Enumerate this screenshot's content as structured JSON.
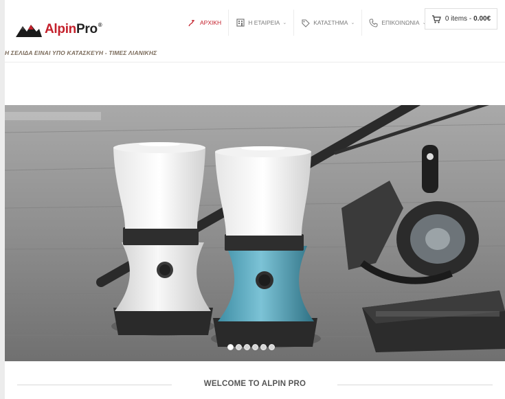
{
  "brand": {
    "name_red": "Alpin",
    "name_dark": "Pro",
    "registered": "®"
  },
  "tagline": "Η ΣΕΛΙΔΑ ΕΙΝΑΙ ΥΠΟ ΚΑΤΑΣΚΕΥΗ - ΤΙΜΕΣ ΛΙΑΝΙΚΗΣ",
  "nav": {
    "items": [
      {
        "label": "ΑΡΧΙΚΗ",
        "icon": "home-icon",
        "active": true
      },
      {
        "label": "Η ΕΤΑΙΡΕΙΑ",
        "icon": "building-icon",
        "dropdown": true
      },
      {
        "label": "ΚΑΤΑΣΤΗΜΑ",
        "icon": "tag-icon",
        "dropdown": true
      },
      {
        "label": "ΕΠΙΚΟΙΝΩΝΙΑ",
        "icon": "phone-icon",
        "dropdown": true
      }
    ],
    "caret": "⌄"
  },
  "cart": {
    "count_label": "0 items -",
    "total": "0.00€",
    "icon": "cart-icon"
  },
  "slider": {
    "slide_count": 6,
    "active_index": 0
  },
  "welcome": {
    "title": "WELCOME TO ALPIN PRO"
  },
  "colors": {
    "accent": "#c4202b",
    "text": "#333333",
    "muted": "#7a7a7a"
  }
}
